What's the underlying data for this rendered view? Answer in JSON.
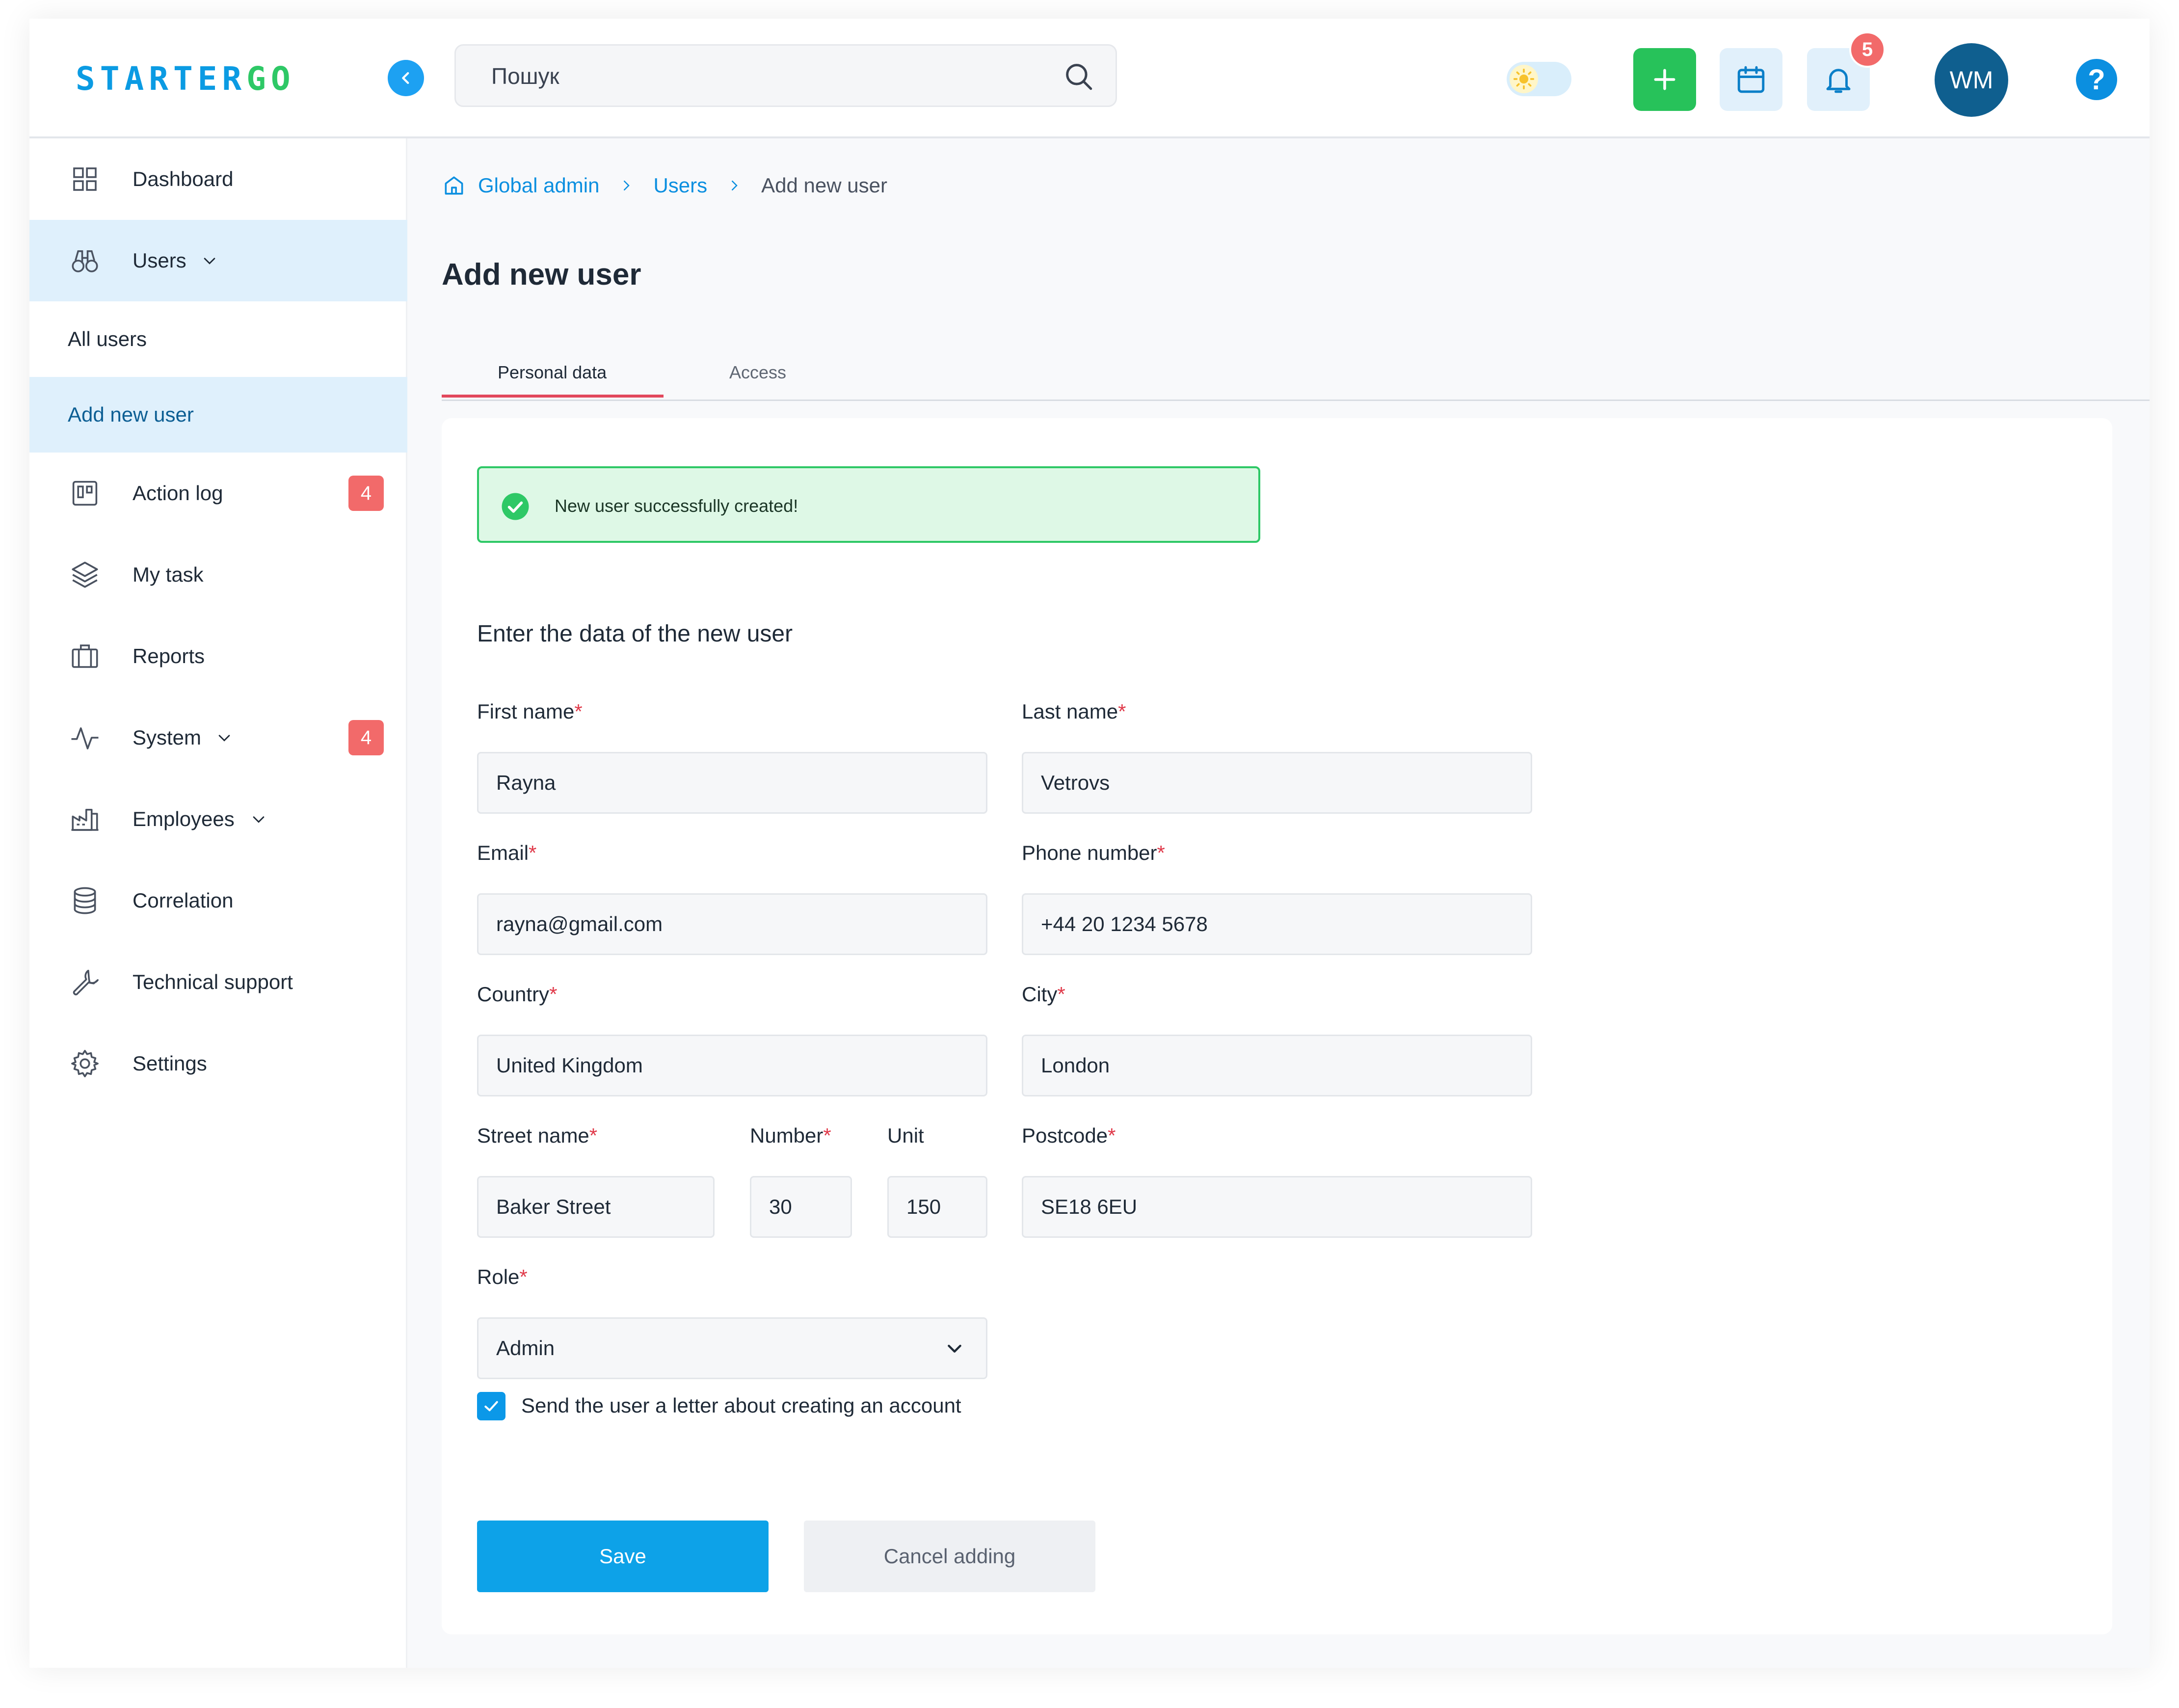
{
  "app": {
    "logo_main": "STARTER",
    "logo_accent": "GO"
  },
  "header": {
    "search_placeholder": "Пошук",
    "notifications_count": "5",
    "user_initials": "WM",
    "help_label": "?"
  },
  "sidebar": {
    "items": [
      {
        "label": "Dashboard",
        "icon": "grid-icon"
      },
      {
        "label": "Users",
        "icon": "binoculars-icon"
      },
      {
        "label": "Action log",
        "icon": "kanban-icon",
        "badge": "4"
      },
      {
        "label": "My task",
        "icon": "layers-icon"
      },
      {
        "label": "Reports",
        "icon": "briefcase-icon"
      },
      {
        "label": "System",
        "icon": "activity-icon",
        "badge": "4"
      },
      {
        "label": "Employees",
        "icon": "factory-icon"
      },
      {
        "label": "Correlation",
        "icon": "database-icon"
      },
      {
        "label": "Technical support",
        "icon": "wrench-icon"
      },
      {
        "label": "Settings",
        "icon": "gear-icon"
      }
    ],
    "sub_items": [
      {
        "label": "All users"
      },
      {
        "label": "Add new user"
      }
    ]
  },
  "breadcrumb": {
    "items": [
      "Global admin",
      "Users",
      "Add new user"
    ]
  },
  "page": {
    "title": "Add new user",
    "tabs": [
      "Personal data",
      "Access"
    ]
  },
  "alert": {
    "text": "New user successfully created!"
  },
  "form": {
    "section_title": "Enter the data of the new user",
    "required_mark": "*",
    "first_name": {
      "label": "First name",
      "value": "Rayna"
    },
    "last_name": {
      "label": "Last name",
      "value": "Vetrovs"
    },
    "email": {
      "label": "Email",
      "value": "rayna@gmail.com"
    },
    "phone": {
      "label": "Phone number",
      "value": "+44 20 1234 5678"
    },
    "country": {
      "label": "Country",
      "value": "United Kingdom"
    },
    "city": {
      "label": "City",
      "value": "London"
    },
    "street": {
      "label": "Street name",
      "value": "Baker Street"
    },
    "number": {
      "label": "Number",
      "value": "30"
    },
    "unit": {
      "label": "Unit",
      "value": "150"
    },
    "postcode": {
      "label": "Postcode",
      "value": "SE18 6EU"
    },
    "role": {
      "label": "Role",
      "value": "Admin"
    },
    "send_letter": {
      "label": "Send the user a letter about creating an account",
      "checked": true
    },
    "save_label": "Save",
    "cancel_label": "Cancel adding"
  },
  "colors": {
    "accent": "#0da2e8",
    "success": "#2ec866",
    "danger": "#f26a6a",
    "active_bg": "#dff0fc"
  }
}
